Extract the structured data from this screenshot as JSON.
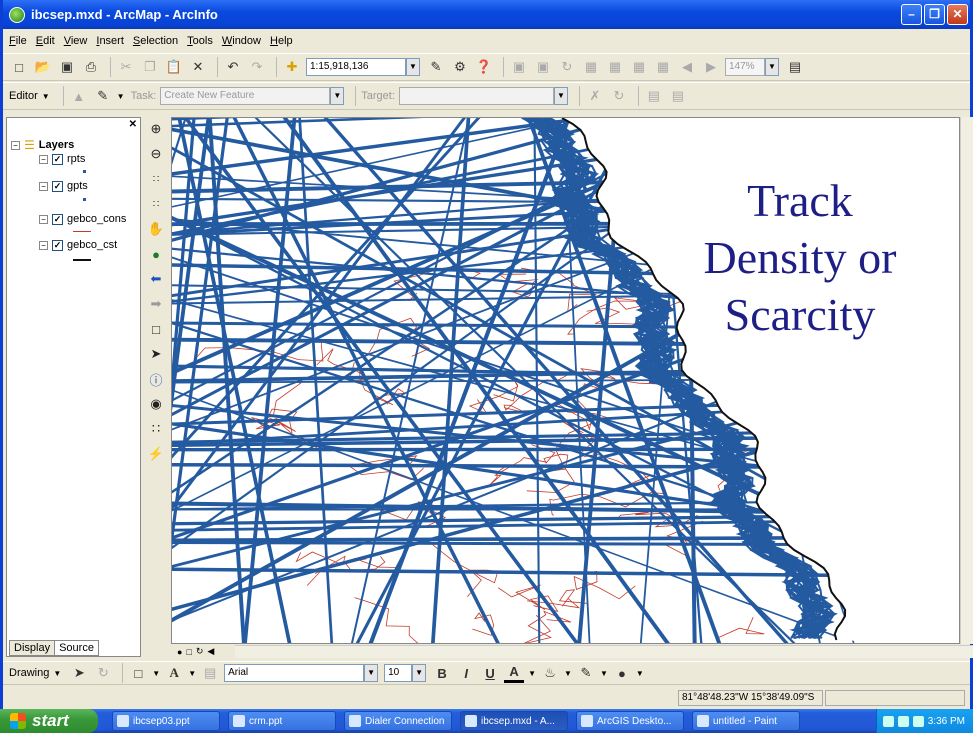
{
  "window": {
    "title": "ibcsep.mxd - ArcMap - ArcInfo"
  },
  "menu": [
    "File",
    "Edit",
    "View",
    "Insert",
    "Selection",
    "Tools",
    "Window",
    "Help"
  ],
  "standard_toolbar": {
    "scale": "1:15,918,136",
    "zoom_percent": "147%"
  },
  "editor_toolbar": {
    "editor_label": "Editor",
    "task_label": "Task:",
    "task_value": "Create New Feature",
    "target_label": "Target:",
    "target_value": ""
  },
  "toc": {
    "root_label": "Layers",
    "layers": [
      {
        "name": "rpts",
        "checked": true
      },
      {
        "name": "gpts",
        "checked": true
      },
      {
        "name": "gebco_cons",
        "checked": true
      },
      {
        "name": "gebco_cst",
        "checked": true
      }
    ],
    "tabs": [
      "Display",
      "Source"
    ]
  },
  "overlay": {
    "lines": [
      "Track",
      "Density or",
      "Scarcity"
    ]
  },
  "drawing_toolbar": {
    "label": "Drawing",
    "font": "Arial",
    "size": "10",
    "bold": "B",
    "italic": "I",
    "underline": "U"
  },
  "status": {
    "coords": "81°48'48.23\"W  15°38'49.09\"S"
  },
  "taskbar": {
    "start_label": "start",
    "tasks": [
      "ibcsep03.ppt",
      "crm.ppt",
      "Dialer Connection",
      "ibcsep.mxd - A...",
      "ArcGIS Deskto...",
      "untitled - Paint"
    ],
    "clock": "3:36 PM"
  },
  "colors": {
    "track": "#245aa0",
    "contour": "#c23a2a",
    "coast": "#111111",
    "overlay_text": "#1d1e86"
  }
}
